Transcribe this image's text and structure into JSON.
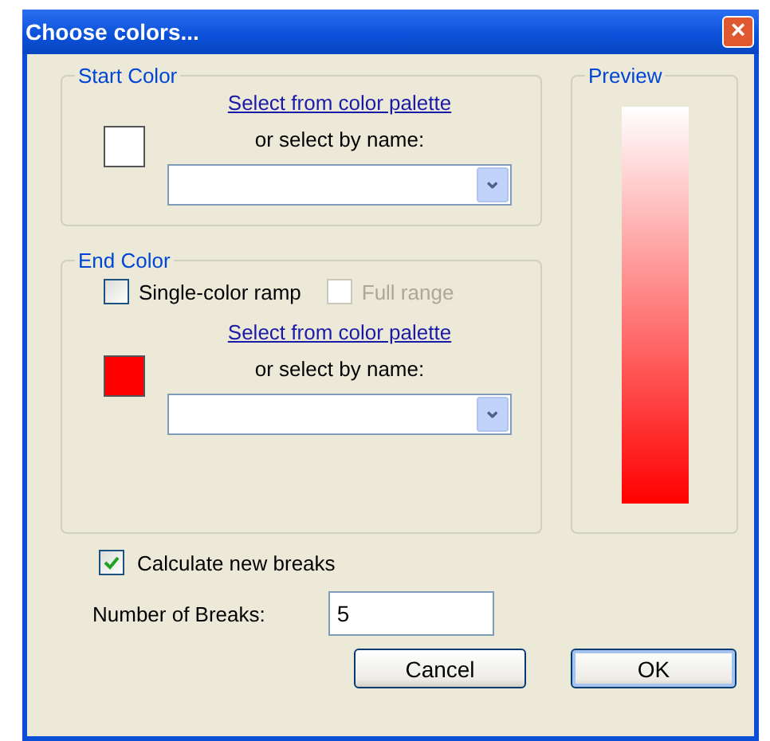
{
  "window": {
    "title": "Choose colors...",
    "close": "×"
  },
  "start_color": {
    "title": "Start Color",
    "color": "#ffffff",
    "palette_link": "Select from color palette",
    "by_name_label": "or select by name:",
    "dropdown": {
      "arrow": "⌄"
    }
  },
  "end_color": {
    "title": "End Color",
    "single_color_ramp": {
      "label": "Single-color ramp",
      "checked": false
    },
    "full_range": {
      "label": "Full range",
      "checked": false,
      "disabled": true
    },
    "color": "#ff0000",
    "palette_link": "Select from color palette",
    "by_name_label": "or select by name:",
    "dropdown": {
      "arrow": "⌄"
    }
  },
  "preview": {
    "title": "Preview"
  },
  "calculate_new_breaks": {
    "label": "Calculate new breaks",
    "checked": true
  },
  "number_of_breaks": {
    "label": "Number of Breaks:",
    "value": "5"
  },
  "buttons": [
    {
      "label": "Cancel",
      "default": false
    },
    {
      "label": "OK",
      "default": true
    }
  ]
}
